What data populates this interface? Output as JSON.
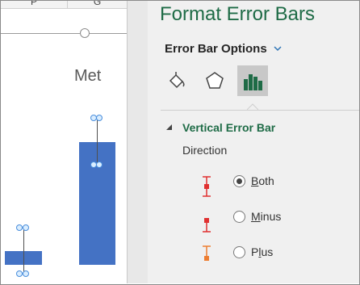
{
  "sheet": {
    "column_headers": [
      "P",
      "G"
    ]
  },
  "chart": {
    "title_fragment": "Met"
  },
  "pane": {
    "title": "Format Error Bars",
    "options_menu": "Error Bar Options",
    "icons": [
      "paint-bucket-icon",
      "pentagon-icon",
      "bar-chart-icon"
    ],
    "section": {
      "title": "Vertical Error Bar",
      "direction_label": "Direction",
      "options": [
        {
          "label": "Both",
          "accel": "B",
          "rest": "oth",
          "checked": true,
          "icon_color": "#e03030"
        },
        {
          "label": "Minus",
          "accel": "M",
          "rest": "inus",
          "checked": false,
          "icon_color": "#e03030"
        },
        {
          "label": "Plus",
          "accel": "l",
          "pre": "P",
          "rest": "us",
          "checked": false,
          "icon_color": "#ed7d31"
        }
      ]
    }
  },
  "colors": {
    "accent_green": "#1e6b46",
    "bar_blue": "#4472c4",
    "selected_icon_bg": "#c8c8c8"
  }
}
